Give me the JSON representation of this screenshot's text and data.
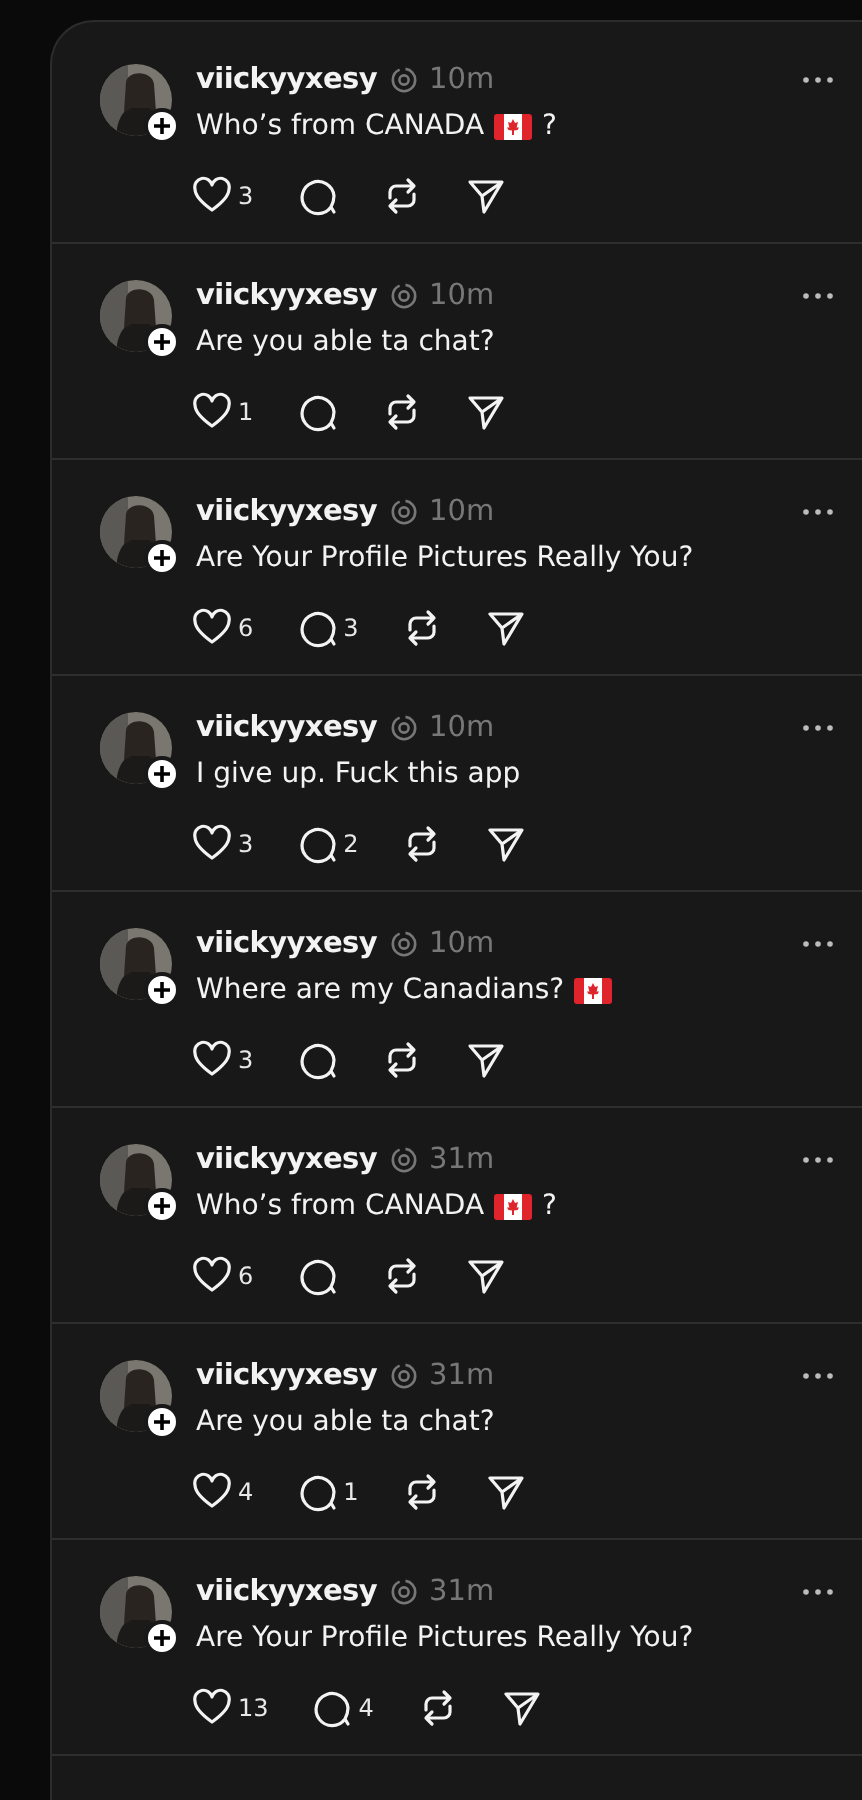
{
  "posts": [
    {
      "username": "viickyyxesy",
      "time": "10m",
      "content": [
        {
          "kind": "text",
          "text": "Who’s from CANADA"
        },
        {
          "kind": "flag"
        },
        {
          "kind": "text",
          "text": "?"
        }
      ],
      "likes": "3"
    },
    {
      "username": "viickyyxesy",
      "time": "10m",
      "content": [
        {
          "kind": "text",
          "text": "Are you able ta chat?"
        }
      ],
      "likes": "1"
    },
    {
      "username": "viickyyxesy",
      "time": "10m",
      "content": [
        {
          "kind": "text",
          "text": "Are Your Profile Pictures Really You?"
        }
      ],
      "likes": "6",
      "replies": "3"
    },
    {
      "username": "viickyyxesy",
      "time": "10m",
      "content": [
        {
          "kind": "text",
          "text": "I give up. Fuck this app"
        }
      ],
      "likes": "3",
      "replies": "2"
    },
    {
      "username": "viickyyxesy",
      "time": "10m",
      "content": [
        {
          "kind": "text",
          "text": "Where are my Canadians?"
        },
        {
          "kind": "flag"
        }
      ],
      "likes": "3"
    },
    {
      "username": "viickyyxesy",
      "time": "31m",
      "content": [
        {
          "kind": "text",
          "text": "Who’s from CANADA"
        },
        {
          "kind": "flag"
        },
        {
          "kind": "text",
          "text": "?"
        }
      ],
      "likes": "6"
    },
    {
      "username": "viickyyxesy",
      "time": "31m",
      "content": [
        {
          "kind": "text",
          "text": "Are you able ta chat?"
        }
      ],
      "likes": "4",
      "replies": "1"
    },
    {
      "username": "viickyyxesy",
      "time": "31m",
      "content": [
        {
          "kind": "text",
          "text": "Are Your Profile Pictures Really You?"
        }
      ],
      "likes": "13",
      "replies": "4"
    }
  ]
}
